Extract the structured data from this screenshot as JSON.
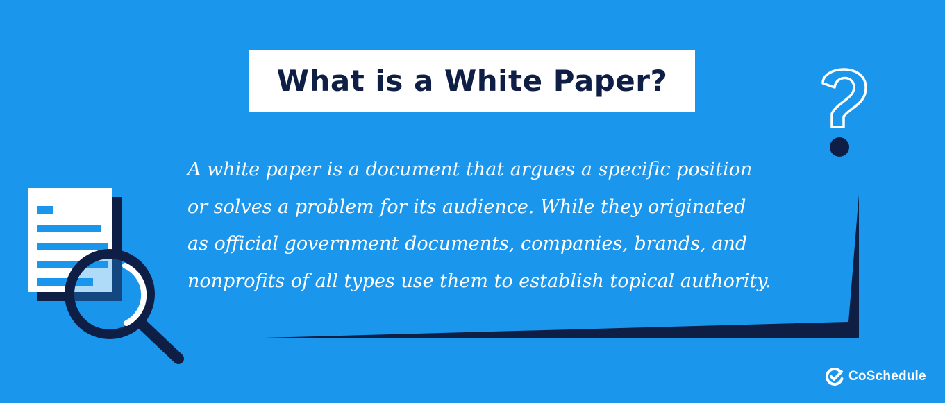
{
  "colors": {
    "background": "#1a96ec",
    "title_text": "#0f1e45",
    "navy_accent": "#0f1e45",
    "white": "#ffffff"
  },
  "header": {
    "title": "What is a White Paper?"
  },
  "body": {
    "lines": [
      "A white paper is a document that argues a specific position",
      "or solves a problem for its audience. While they originated",
      "as official government documents, companies, brands, and",
      "nonprofits of all types use them to establish topical authority."
    ]
  },
  "illustrations": {
    "document_icon": "document-icon",
    "magnifier_icon": "magnifying-glass-icon",
    "question_icon": "question-mark-icon"
  },
  "brand": {
    "name": "CoSchedule",
    "icon": "coschedule-check-icon"
  }
}
